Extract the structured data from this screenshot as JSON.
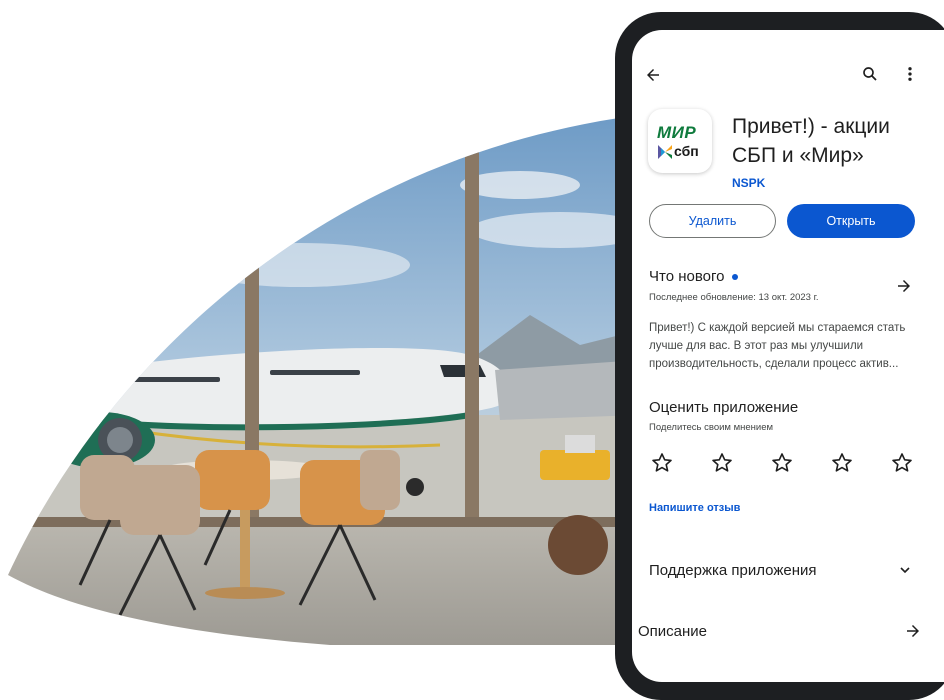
{
  "app": {
    "title": "Привет!) - акции СБП и «Мир»",
    "developer": "NSPK",
    "icon_text_top": "МИР",
    "icon_text_bottom": "сбп"
  },
  "toolbar": {
    "back_icon": "arrow-left-icon",
    "search_icon": "search-icon",
    "menu_icon": "more-vert-icon"
  },
  "actions": {
    "uninstall_label": "Удалить",
    "open_label": "Открыть"
  },
  "whats_new": {
    "title": "Что нового",
    "updated": "Последнее обновление: 13 окт. 2023 г.",
    "text": "Привет!) С каждой версией мы стараемся стать лучше для вас. В этот раз мы улучшили производительность, сделали процесс актив..."
  },
  "rate": {
    "title": "Оценить приложение",
    "subtitle": "Поделитесь своим мнением",
    "stars": 5,
    "write_review": "Напишите отзыв"
  },
  "support": {
    "title": "Поддержка приложения"
  },
  "description": {
    "title": "Описание"
  },
  "colors": {
    "accent": "#0b57d0",
    "phone_frame": "#1d1f22",
    "brand_green": "#0f7b3d"
  }
}
